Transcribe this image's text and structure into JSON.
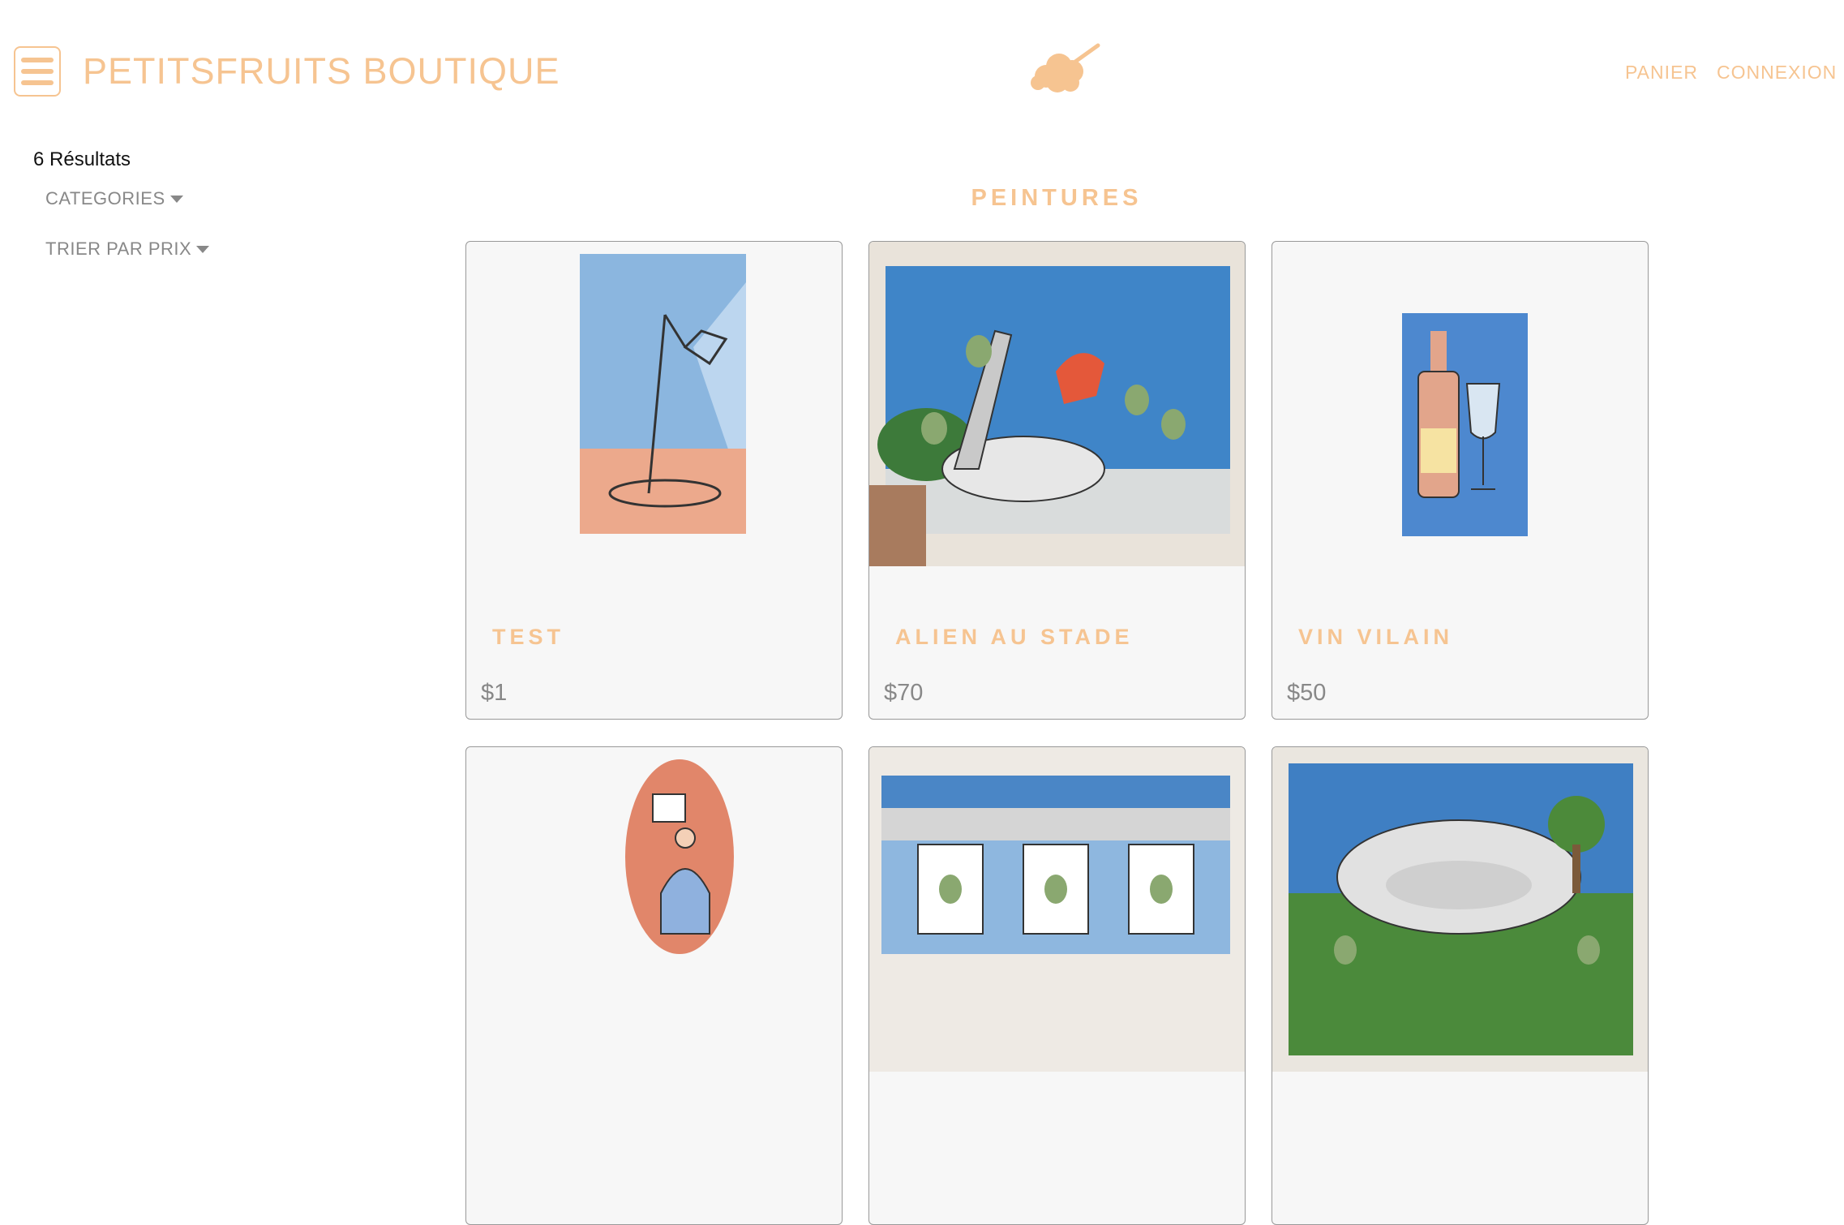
{
  "header": {
    "brand": "PETITSFRUITS BOUTIQUE",
    "nav": {
      "cart": "PANIER",
      "login": "CONNEXION"
    },
    "accent_color": "#f6c491"
  },
  "sidebar": {
    "results": "6 Résultats",
    "filters": {
      "categories": "CATEGORIES",
      "sort_price": "TRIER PAR PRIX"
    }
  },
  "main": {
    "section_title": "PEINTURES",
    "products": [
      {
        "title": "TEST",
        "price": "$1"
      },
      {
        "title": "ALIEN AU STADE",
        "price": "$70"
      },
      {
        "title": "VIN VILAIN",
        "price": "$50"
      },
      {
        "title": "",
        "price": ""
      },
      {
        "title": "",
        "price": ""
      },
      {
        "title": "",
        "price": ""
      }
    ]
  }
}
